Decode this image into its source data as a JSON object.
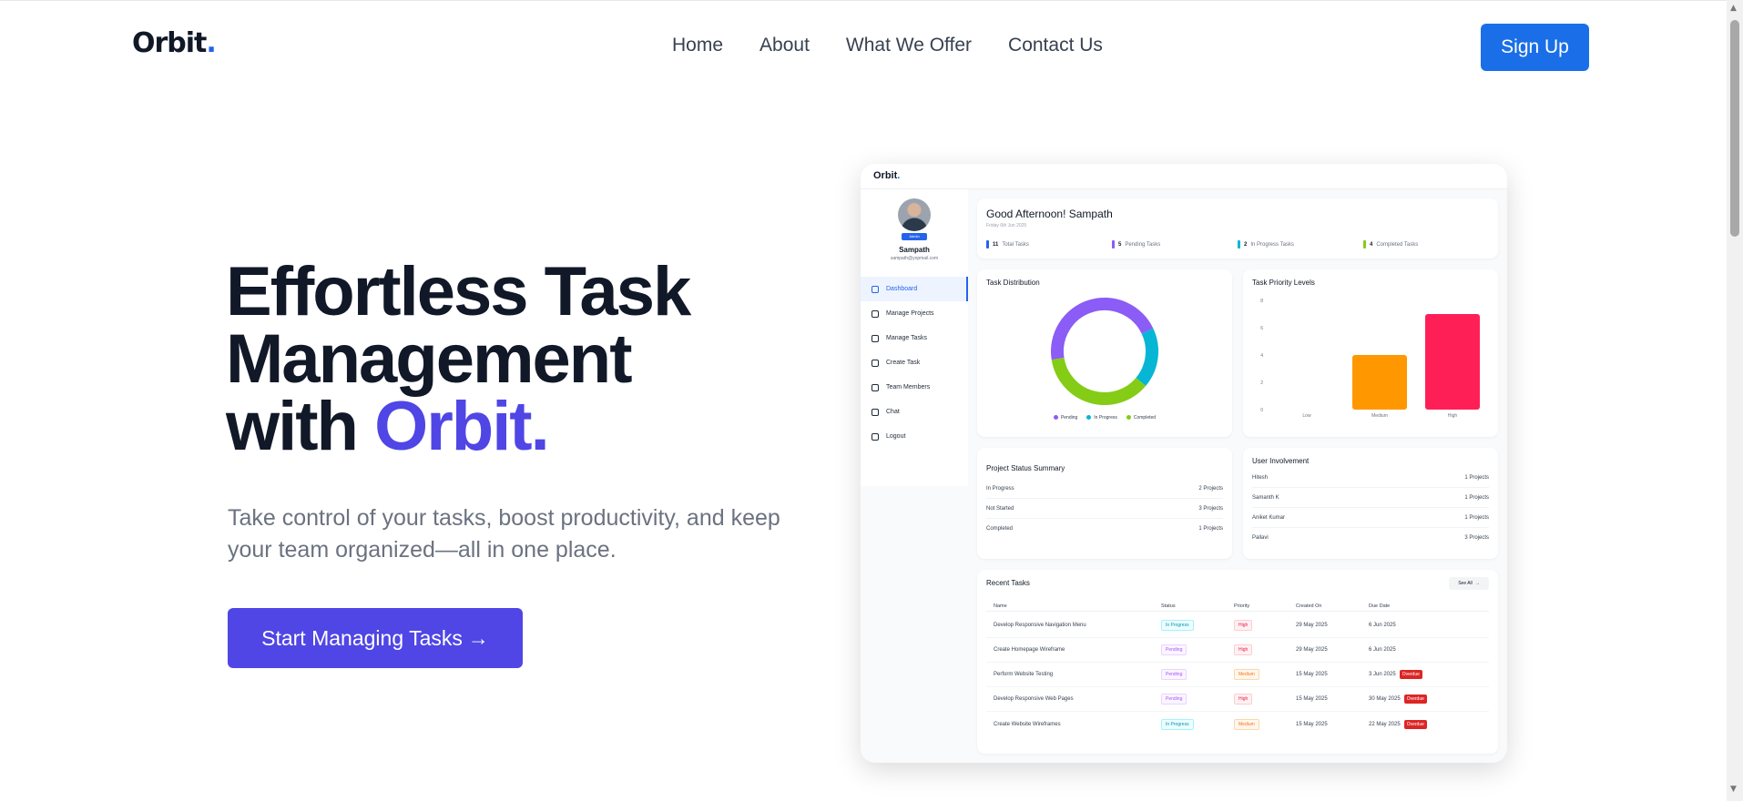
{
  "header": {
    "logo_text": "Orbit",
    "logo_dot": ".",
    "nav": [
      "Home",
      "About",
      "What We Offer",
      "Contact Us"
    ],
    "signup_label": "Sign Up"
  },
  "hero": {
    "title_line1": "Effortless Task",
    "title_line2": "Management",
    "title_line3_prefix": "with ",
    "title_line3_accent": "Orbit.",
    "subtitle": "Take control of your tasks, boost productivity, and keep your team organized—all in one place.",
    "cta_label": "Start Managing Tasks",
    "cta_icon": "arrow-right-icon"
  },
  "dashboard": {
    "logo_text": "Orbit",
    "user": {
      "role": "Admin",
      "name": "Sampath",
      "email": "sampath@yopmail.com"
    },
    "menu": [
      {
        "label": "Dashboard",
        "icon": "grid-icon",
        "active": true
      },
      {
        "label": "Manage Projects",
        "icon": "folder-icon",
        "active": false
      },
      {
        "label": "Manage Tasks",
        "icon": "clipboard-icon",
        "active": false
      },
      {
        "label": "Create Task",
        "icon": "plus-square-icon",
        "active": false
      },
      {
        "label": "Team Members",
        "icon": "users-icon",
        "active": false
      },
      {
        "label": "Chat",
        "icon": "chat-icon",
        "active": false
      },
      {
        "label": "Logout",
        "icon": "logout-icon",
        "active": false
      }
    ],
    "greeting": "Good Afternoon! Sampath",
    "date": "Friday 6th Jun 2025",
    "stats": [
      {
        "count": "11",
        "label": "Total Tasks",
        "color": "#2563eb"
      },
      {
        "count": "5",
        "label": "Pending Tasks",
        "color": "#8b5cf6"
      },
      {
        "count": "2",
        "label": "In Progress Tasks",
        "color": "#06b6d4"
      },
      {
        "count": "4",
        "label": "Completed Tasks",
        "color": "#84cc16"
      }
    ],
    "distribution_title": "Task Distribution",
    "priority_title": "Task Priority Levels",
    "project_status_title": "Project Status Summary",
    "project_status": [
      {
        "label": "In Progress",
        "value": "2 Projects"
      },
      {
        "label": "Not Started",
        "value": "3 Projects"
      },
      {
        "label": "Completed",
        "value": "1 Projects"
      }
    ],
    "involvement_title": "User Involvement",
    "involvement": [
      {
        "label": "Hitesh",
        "value": "1 Projects"
      },
      {
        "label": "Samanth K",
        "value": "1 Projects"
      },
      {
        "label": "Aniket Kumar",
        "value": "1 Projects"
      },
      {
        "label": "Pallavi",
        "value": "3 Projects"
      }
    ],
    "recent_title": "Recent Tasks",
    "see_all_label": "See All",
    "table_headers": [
      "Name",
      "Status",
      "Priority",
      "Created On",
      "Due Date"
    ],
    "tasks": [
      {
        "name": "Develop Responsive Navigation Menu",
        "status": "In Progress",
        "status_kind": "inprog",
        "priority": "High",
        "priority_kind": "high",
        "created": "29 May 2025",
        "due": "6 Jun 2025",
        "overdue": ""
      },
      {
        "name": "Create Homepage Wireframe",
        "status": "Pending",
        "status_kind": "pending",
        "priority": "High",
        "priority_kind": "high",
        "created": "29 May 2025",
        "due": "6 Jun 2025",
        "overdue": ""
      },
      {
        "name": "Perform Website Testing",
        "status": "Pending",
        "status_kind": "pending",
        "priority": "Medium",
        "priority_kind": "medium",
        "created": "15 May 2025",
        "due": "3 Jun 2025",
        "overdue": "Overdue"
      },
      {
        "name": "Develop Responsive Web Pages",
        "status": "Pending",
        "status_kind": "pending",
        "priority": "High",
        "priority_kind": "high",
        "created": "15 May 2025",
        "due": "30 May 2025",
        "overdue": "Overdue"
      },
      {
        "name": "Create Website Wireframes",
        "status": "In Progress",
        "status_kind": "inprog",
        "priority": "Medium",
        "priority_kind": "medium",
        "created": "15 May 2025",
        "due": "22 May 2025",
        "overdue": "Overdue"
      }
    ]
  },
  "chart_data": [
    {
      "type": "pie",
      "title": "Task Distribution",
      "categories": [
        "Pending",
        "In Progress",
        "Completed"
      ],
      "values": [
        5,
        2,
        4
      ],
      "colors": [
        "#8b5cf6",
        "#06b6d4",
        "#84cc16"
      ],
      "legend": "bottom"
    },
    {
      "type": "bar",
      "title": "Task Priority Levels",
      "categories": [
        "Low",
        "Medium",
        "High"
      ],
      "values": [
        0,
        4,
        7
      ],
      "colors": [
        "#22c55e",
        "#ff9800",
        "#ff1f57"
      ],
      "ylim": [
        0,
        8
      ],
      "yticks": [
        0,
        2,
        4,
        6,
        8
      ]
    }
  ]
}
